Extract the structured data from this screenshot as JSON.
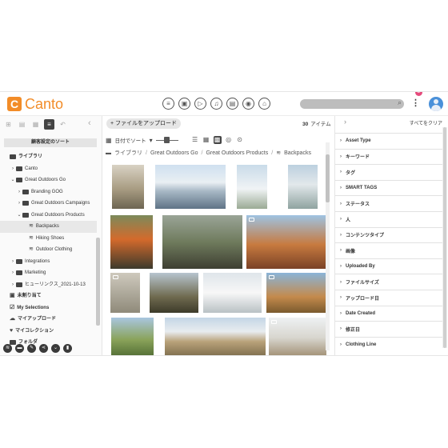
{
  "header": {
    "logo_letter": "C",
    "logo_text": "Canto",
    "notification_count": "2",
    "apps": [
      "≡",
      "▣",
      "▷",
      "♫",
      "▤",
      "◉",
      "⌂"
    ]
  },
  "left_panel": {
    "sort_label": "顧客設定のソート",
    "tree": [
      {
        "label": "ライブラリ",
        "level": 0,
        "caret": "",
        "icon": "folder",
        "bold": true
      },
      {
        "label": "Canto",
        "level": 1,
        "caret": "›",
        "icon": "folder"
      },
      {
        "label": "Great Outdoors Go",
        "level": 1,
        "caret": "⌄",
        "icon": "folder"
      },
      {
        "label": "Branding GOG",
        "level": 2,
        "caret": "›",
        "icon": "folder"
      },
      {
        "label": "Great Outdoors Campaigns",
        "level": 2,
        "caret": "›",
        "icon": "folder"
      },
      {
        "label": "Great Outdoors Products",
        "level": 2,
        "caret": "⌄",
        "icon": "folder"
      },
      {
        "label": "Backpacks",
        "level": 3,
        "caret": "",
        "icon": "stack",
        "selected": true
      },
      {
        "label": "Hiking Shoes",
        "level": 3,
        "caret": "",
        "icon": "stack"
      },
      {
        "label": "Outdoor Clothing",
        "level": 3,
        "caret": "",
        "icon": "stack"
      },
      {
        "label": "Integrations",
        "level": 1,
        "caret": "›",
        "icon": "folder"
      },
      {
        "label": "Marketing",
        "level": 1,
        "caret": "›",
        "icon": "folder"
      },
      {
        "label": "ヒューリンクス_2021-10-13",
        "level": 1,
        "caret": "›",
        "icon": "folder"
      },
      {
        "label": "未割り当て",
        "level": 0,
        "caret": "",
        "icon": "box",
        "bold": true
      },
      {
        "label": "My Selections",
        "level": 0,
        "caret": "",
        "icon": "check",
        "bold": true
      },
      {
        "label": "マイアップロード",
        "level": 0,
        "caret": "",
        "icon": "cloud",
        "bold": true
      },
      {
        "label": "マイコレクション",
        "level": 0,
        "caret": "",
        "icon": "heart",
        "bold": true
      },
      {
        "label": "フォルダ",
        "level": 0,
        "caret": "",
        "icon": "folder",
        "bold": true
      }
    ]
  },
  "main": {
    "upload_label": "+ ファイルをアップロード",
    "item_count": "30",
    "item_unit": "アイテム",
    "sort_date": "日付でソート",
    "breadcrumb": [
      "ライブラリ",
      "Great Outdoors Go",
      "Great Outdoors Products",
      "Backpacks"
    ]
  },
  "right_panel": {
    "clear_all": "すべてをクリア",
    "filters": [
      "Asset Type",
      "キーワード",
      "タグ",
      "SMART TAGS",
      "ステータス",
      "人",
      "コンテンツタイプ",
      "画像",
      "Uploaded By",
      "ファイルサイズ",
      "アップロード日",
      "Date Created",
      "修正日",
      "Clothing Line"
    ]
  },
  "colors": {
    "brand": "#f28c28",
    "notification": "#e54b7c",
    "avatar": "#4a90d9"
  }
}
